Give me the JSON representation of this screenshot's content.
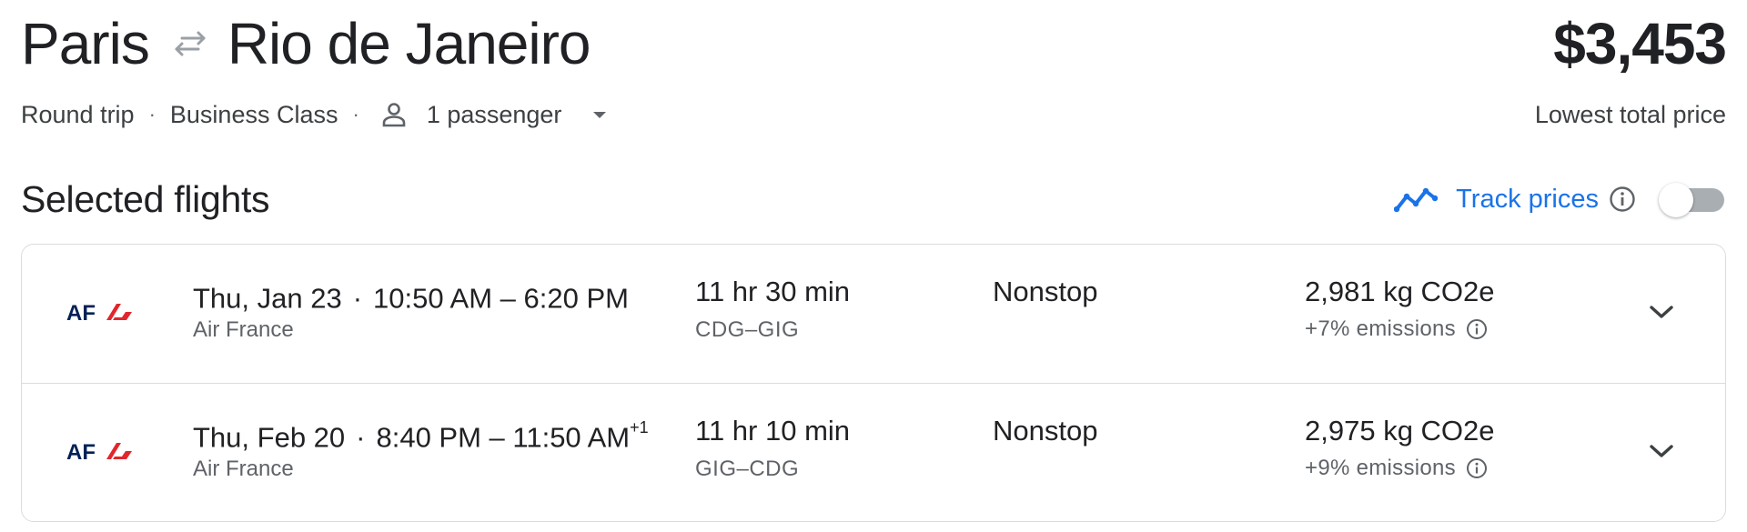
{
  "header": {
    "origin": "Paris",
    "destination": "Rio de Janeiro",
    "swap_icon": "swap-arrows-icon",
    "price": "$3,453",
    "price_caption": "Lowest total price"
  },
  "trip_meta": {
    "trip_type": "Round trip",
    "separator": "·",
    "cabin_class": "Business Class",
    "passenger_icon": "person-icon",
    "passengers": "1 passenger",
    "dropdown_icon": "caret-down-icon"
  },
  "selected": {
    "title": "Selected flights",
    "track_icon": "trend-line-icon",
    "track_label": "Track prices",
    "info_icon": "info-icon",
    "track_enabled": false
  },
  "flights": [
    {
      "airline_logo": "AF",
      "date": "Thu, Jan 23",
      "dot": "·",
      "times": "10:50 AM – 6:20 PM",
      "day_offset": "",
      "airline": "Air France",
      "duration": "11 hr 30 min",
      "route": "CDG–GIG",
      "stops": "Nonstop",
      "emissions": "2,981 kg CO2e",
      "emissions_delta": "+7% emissions"
    },
    {
      "airline_logo": "AF",
      "date": "Thu, Feb 20",
      "dot": "·",
      "times": "8:40 PM – 11:50 AM",
      "day_offset": "+1",
      "airline": "Air France",
      "duration": "11 hr 10 min",
      "route": "GIG–CDG",
      "stops": "Nonstop",
      "emissions": "2,975 kg CO2e",
      "emissions_delta": "+9% emissions"
    }
  ],
  "colors": {
    "text_primary": "#202124",
    "text_secondary": "#5f6368",
    "accent_blue": "#1a73e8",
    "border": "#dadce0",
    "airfrance_blue": "#002157",
    "airfrance_red": "#e1262d"
  }
}
